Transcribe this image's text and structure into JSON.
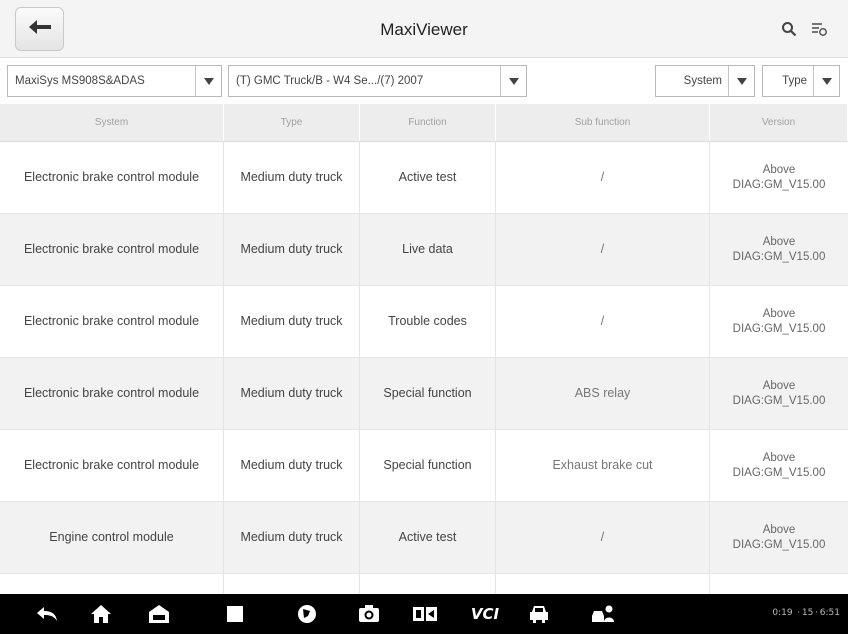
{
  "header": {
    "title": "MaxiViewer",
    "back_icon": "back-arrow-icon",
    "search_icon": "search-icon",
    "filter_icon": "filter-icon"
  },
  "filters": {
    "model": "MaxiSys MS908S&ADAS",
    "vehicle": "(T) GMC Truck/B - W4 Se.../(7) 2007",
    "system": "System",
    "type": "Type"
  },
  "table": {
    "columns": [
      "System",
      "Type",
      "Function",
      "Sub function",
      "Version"
    ],
    "rows": [
      {
        "system": "Electronic brake control module",
        "type": "Medium duty truck",
        "function": "Active test",
        "sub": "/",
        "version_1": "Above",
        "version_2": "DIAG:GM_V15.00"
      },
      {
        "system": "Electronic brake control module",
        "type": "Medium duty truck",
        "function": "Live data",
        "sub": "/",
        "version_1": "Above",
        "version_2": "DIAG:GM_V15.00"
      },
      {
        "system": "Electronic brake control module",
        "type": "Medium duty truck",
        "function": "Trouble codes",
        "sub": "/",
        "version_1": "Above",
        "version_2": "DIAG:GM_V15.00"
      },
      {
        "system": "Electronic brake control module",
        "type": "Medium duty truck",
        "function": "Special function",
        "sub": "ABS relay",
        "version_1": "Above",
        "version_2": "DIAG:GM_V15.00"
      },
      {
        "system": "Electronic brake control module",
        "type": "Medium duty truck",
        "function": "Special function",
        "sub": "Exhaust brake cut",
        "version_1": "Above",
        "version_2": "DIAG:GM_V15.00"
      },
      {
        "system": "Engine control module",
        "type": "Medium duty truck",
        "function": "Active test",
        "sub": "/",
        "version_1": "Above",
        "version_2": "DIAG:GM_V15.00"
      }
    ]
  },
  "navbar": {
    "icons": [
      "back-icon",
      "home-icon",
      "car-home-icon",
      "recent-apps-icon",
      "browser-icon",
      "camera-icon",
      "screen-switch-icon",
      "vci-icon",
      "vehicle-icon",
      "car-user-icon"
    ],
    "vci_label": "VCI",
    "status_text": "0:19  · 15 · 6:51"
  },
  "colors": {
    "header_bg": "#f4f4f4",
    "row_alt_bg": "#f2f2f2",
    "navbar_bg": "#000000"
  }
}
